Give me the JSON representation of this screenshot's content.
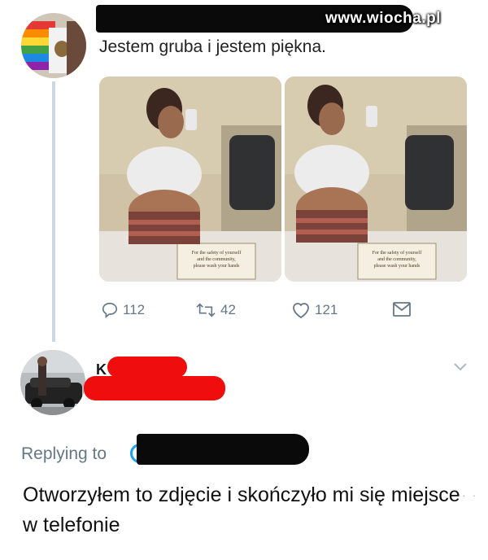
{
  "watermark": "www.wiocha.pl",
  "tweet": {
    "text": "Jestem gruba i jestem piękna.",
    "photos": [
      {
        "alt": "mirror selfie photo",
        "sign_lines": [
          "For the safety of yourself",
          "and the community,",
          "please wash your hands"
        ]
      },
      {
        "alt": "mirror selfie photo",
        "sign_lines": [
          "For the safety of yourself",
          "and the community,",
          "please wash your hands"
        ]
      }
    ],
    "actions": {
      "reply_count": "112",
      "retweet_count": "42",
      "like_count": "121"
    },
    "icons": [
      "reply-icon",
      "retweet-icon",
      "like-icon",
      "message-icon"
    ]
  },
  "reply": {
    "author_initial": "K",
    "replying_to_label": "Replying to",
    "text": "Otworzyłem to zdjęcie i skończyło mi się miejsce w telefonie"
  },
  "colors": {
    "accent": "#1da1f2",
    "muted": "#657786",
    "redaction_red": "#f00d0d",
    "redaction_black": "#0a0a0a"
  }
}
